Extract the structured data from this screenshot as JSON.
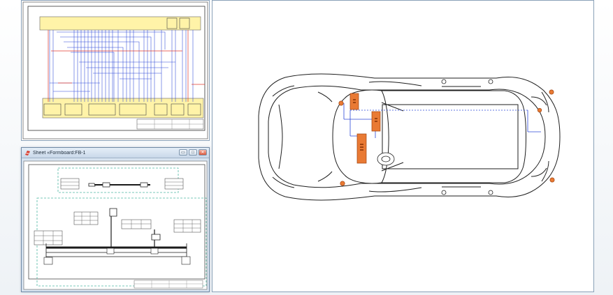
{
  "window": {
    "lower_left_title": "Sheet «Formboard:FB-1"
  },
  "window_buttons": {
    "minimize": "▭",
    "maximize": "□",
    "close": "✕"
  },
  "colors": {
    "pane_border": "#8aa1b8",
    "title_bg": "#d7e3f0",
    "schematic_fill": "#fff3a8",
    "wire_blue": "#2b47d8",
    "wire_red": "#e03a2f",
    "component_orange": "#e97a34",
    "formboard_dashed": "#4fb6a2",
    "vehicle_line": "#222222"
  },
  "icons": {
    "app_icon": "e3-app-icon",
    "minimize_icon": "minimize-icon",
    "maximize_icon": "maximize-icon",
    "close_icon": "close-icon"
  }
}
